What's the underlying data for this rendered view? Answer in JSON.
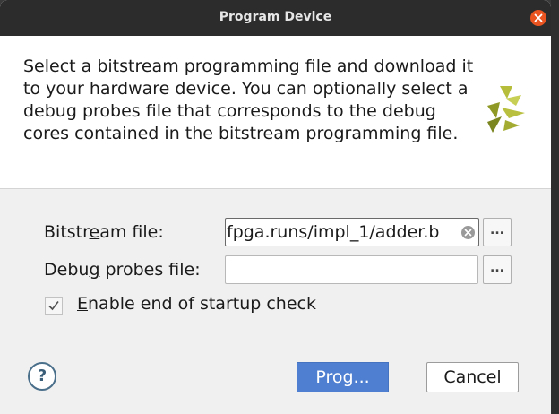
{
  "window": {
    "title": "Program Device",
    "close_icon": "close-icon"
  },
  "banner": {
    "description": "Select a bitstream programming file and download it to your hardware device. You can optionally select a debug probes file that corresponds to the debug cores contained in the bitstream programming file.",
    "logo_icon": "xilinx-logo"
  },
  "form": {
    "bitstream": {
      "label_pre": "Bitstr",
      "label_u": "e",
      "label_post": "am file:",
      "value": "fpga.runs/impl_1/adder.b",
      "browse_label": "..."
    },
    "debug": {
      "label_pre": "Debu",
      "label_u": "g",
      "label_post": " probes file:",
      "value": "",
      "browse_label": "..."
    },
    "startup_check": {
      "label_u": "E",
      "label_post": "nable end of startup check",
      "checked": true
    }
  },
  "footer": {
    "help_label": "?",
    "program_u": "P",
    "program_post": "rog...",
    "cancel_label": "Cancel"
  },
  "colors": {
    "accent": "#4f7fd0",
    "titlebar": "#2c2c2c",
    "close": "#e95420",
    "logo_green": "#9aa32b"
  }
}
